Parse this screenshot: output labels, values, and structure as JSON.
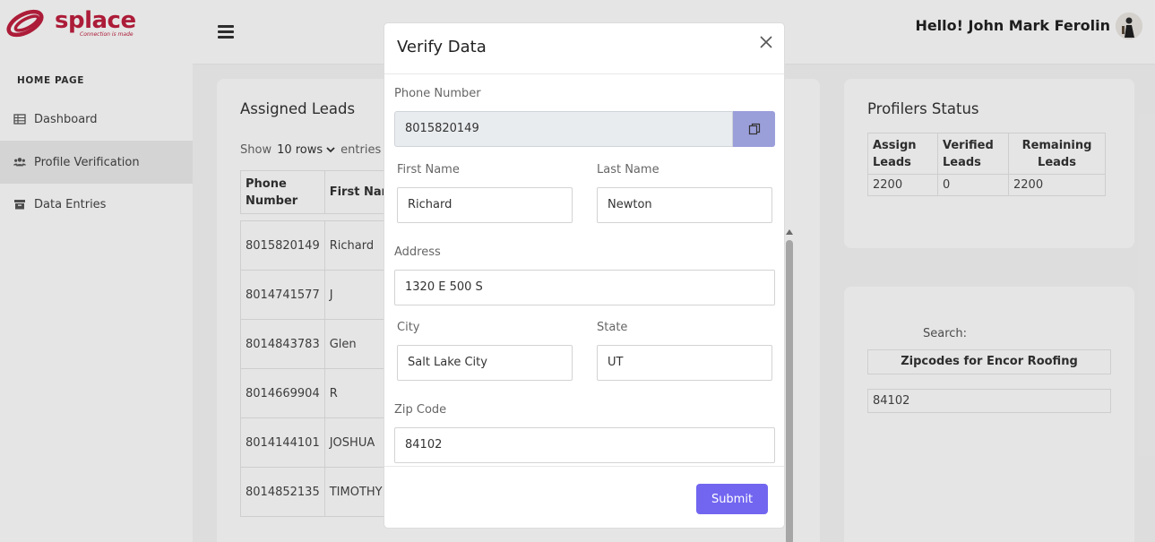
{
  "brand": {
    "name": "splace",
    "tagline": "Connection is made",
    "color": "#c0203f"
  },
  "sidebar": {
    "heading": "HOME PAGE",
    "items": [
      {
        "label": "Dashboard",
        "icon": "table-icon",
        "active": false
      },
      {
        "label": "Profile Verification",
        "icon": "users-icon",
        "active": true
      },
      {
        "label": "Data Entries",
        "icon": "archive-icon",
        "active": false
      }
    ]
  },
  "header": {
    "greeting": "Hello! John Mark Ferolin"
  },
  "leads": {
    "title": "Assigned Leads",
    "show_label": "Show",
    "rows_selected": "10 rows",
    "entries_label": "entries",
    "columns": [
      "Phone Number",
      "First Nam"
    ],
    "rows": [
      [
        "8015820149",
        "Richard"
      ],
      [
        "8014741577",
        "J"
      ],
      [
        "8014843783",
        "Glen"
      ],
      [
        "8014669904",
        "R"
      ],
      [
        "8014144101",
        "JOSHUA"
      ],
      [
        "8014852135",
        "TIMOTHY"
      ]
    ]
  },
  "profilers_status": {
    "title": "Profilers Status",
    "columns": [
      "Assign Leads",
      "Verified Leads",
      "Remaining Leads"
    ],
    "row": [
      "2200",
      "0",
      "2200"
    ]
  },
  "zipcodes": {
    "search_label": "Search:",
    "header": "Zipcodes for Encor Roofing",
    "rows": [
      "84102"
    ]
  },
  "modal": {
    "title": "Verify Data",
    "phone_label": "Phone Number",
    "phone_value": "8015820149",
    "first_name_label": "First Name",
    "first_name_value": "Richard",
    "last_name_label": "Last Name",
    "last_name_value": "Newton",
    "address_label": "Address",
    "address_value": "1320 E 500 S",
    "city_label": "City",
    "city_value": "Salt Lake City",
    "state_label": "State",
    "state_value": "UT",
    "zip_label": "Zip Code",
    "zip_value": "84102",
    "submit_label": "Submit",
    "accent_color": "#7266f0"
  }
}
